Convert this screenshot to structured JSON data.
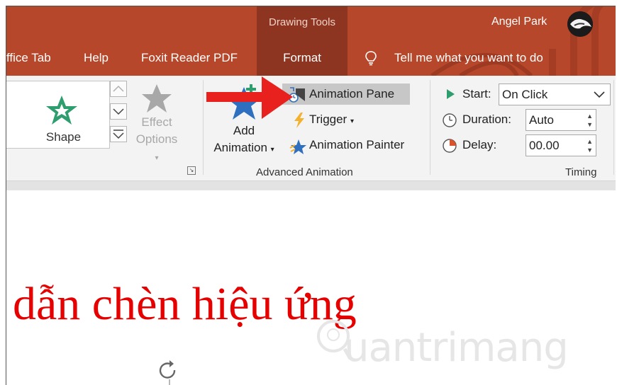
{
  "title_bar": {
    "context_group": "Drawing Tools",
    "user_name": "Angel Park"
  },
  "tabs": {
    "office_tab": "ffice Tab",
    "help": "Help",
    "foxit": "Foxit Reader PDF",
    "format": "Format",
    "tell_me": "Tell me what you want to do"
  },
  "ribbon": {
    "shape_label": "Shape",
    "effect_line1": "Effect",
    "effect_line2": "Options",
    "add_line1": "Add",
    "add_line2": "Animation",
    "animation_pane": "Animation Pane",
    "trigger": "Trigger",
    "animation_painter": "Animation Painter",
    "advanced_group": "Advanced Animation",
    "start_label": "Start:",
    "start_value": "On Click",
    "duration_label": "Duration:",
    "duration_value": "Auto",
    "delay_label": "Delay:",
    "delay_value": "00.00",
    "timing_group": "Timing"
  },
  "slide": {
    "text": "dẫn chèn hiệu ứng",
    "watermark": "uantrimang"
  },
  "colors": {
    "title_bar": "#b7472a",
    "context_group": "#8d3521",
    "slide_text": "#e60000",
    "arrow": "#e8201e"
  }
}
